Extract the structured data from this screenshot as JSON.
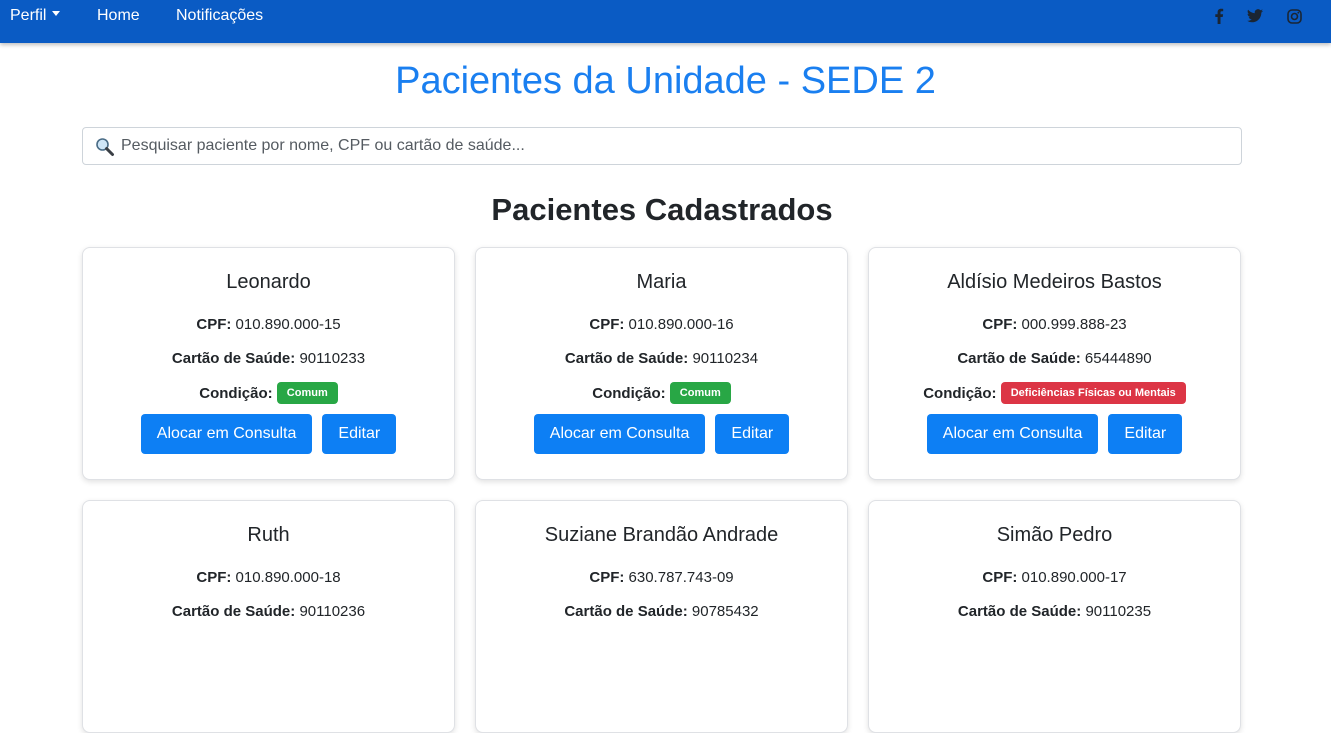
{
  "nav": {
    "profile_label": "Perfil",
    "home_label": "Home",
    "notifications_label": "Notificações",
    "social_icons": [
      "facebook-icon",
      "twitter-icon",
      "instagram-icon"
    ]
  },
  "page": {
    "title": "Pacientes da Unidade - SEDE 2",
    "section_title": "Pacientes Cadastrados"
  },
  "search": {
    "placeholder": "Pesquisar paciente por nome, CPF ou cartão de saúde..."
  },
  "labels": {
    "cpf": "CPF:",
    "health_card": "Cartão de Saúde:",
    "condition": "Condição:",
    "allocate_button": "Alocar em Consulta",
    "edit_button": "Editar"
  },
  "colors": {
    "navbar": "#0a5bc4",
    "title": "#1a7ff0",
    "button": "#0d7ff4",
    "badge_common": "#28a745",
    "badge_disability": "#dc3545"
  },
  "patients": [
    {
      "name": "Leonardo",
      "cpf": "010.890.000-15",
      "health_card": "90110233",
      "condition": "Comum",
      "condition_type": "common"
    },
    {
      "name": "Maria",
      "cpf": "010.890.000-16",
      "health_card": "90110234",
      "condition": "Comum",
      "condition_type": "common"
    },
    {
      "name": "Aldísio Medeiros Bastos",
      "cpf": "000.999.888-23",
      "health_card": "65444890",
      "condition": "Deficiências Físicas ou Mentais",
      "condition_type": "disability"
    },
    {
      "name": "Ruth",
      "cpf": "010.890.000-18",
      "health_card": "90110236"
    },
    {
      "name": "Suziane Brandão Andrade",
      "cpf": "630.787.743-09",
      "health_card": "90785432"
    },
    {
      "name": "Simão Pedro",
      "cpf": "010.890.000-17",
      "health_card": "90110235"
    }
  ]
}
